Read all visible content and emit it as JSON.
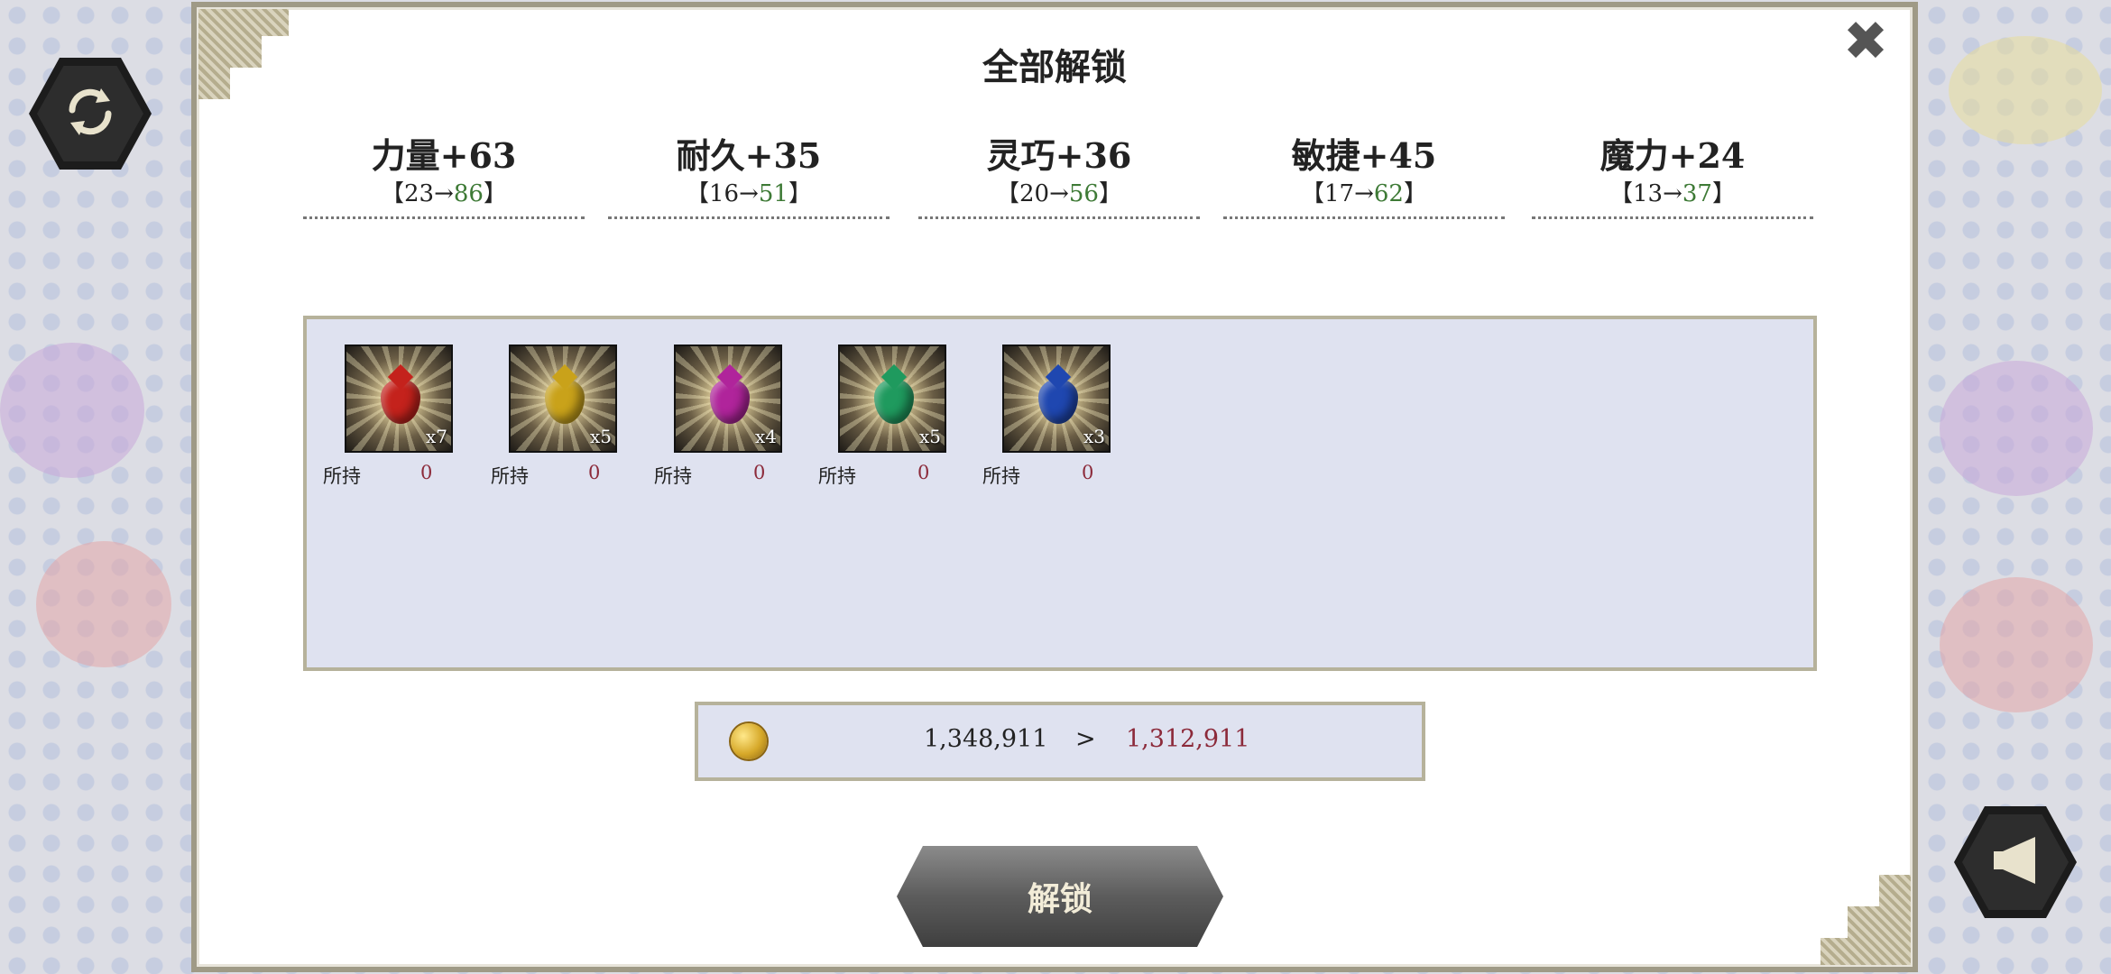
{
  "dialog": {
    "title": "全部解锁",
    "close_icon": "close-icon"
  },
  "stats": [
    {
      "name": "力量+63",
      "range_open": "【23→",
      "range_new": "86",
      "range_close": "】"
    },
    {
      "name": "耐久+35",
      "range_open": "【16→",
      "range_new": "51",
      "range_close": "】"
    },
    {
      "name": "灵巧+36",
      "range_open": "【20→",
      "range_new": "56",
      "range_close": "】"
    },
    {
      "name": "敏捷+45",
      "range_open": "【17→",
      "range_new": "62",
      "range_close": "】"
    },
    {
      "name": "魔力+24",
      "range_open": "【13→",
      "range_new": "37",
      "range_close": "】"
    }
  ],
  "items": [
    {
      "icon": "red-gem-icon",
      "color": "#c4221c",
      "count": "x7",
      "held_label": "所持",
      "held_value": "0"
    },
    {
      "icon": "yellow-gem-icon",
      "color": "#c9a21a",
      "count": "x5",
      "held_label": "所持",
      "held_value": "0"
    },
    {
      "icon": "magenta-gem-icon",
      "color": "#b0249b",
      "count": "x4",
      "held_label": "所持",
      "held_value": "0"
    },
    {
      "icon": "green-gem-icon",
      "color": "#1f9a5e",
      "count": "x5",
      "held_label": "所持",
      "held_value": "0"
    },
    {
      "icon": "blue-gem-icon",
      "color": "#1f47b0",
      "count": "x3",
      "held_label": "所持",
      "held_value": "0"
    }
  ],
  "cost": {
    "icon": "gold-coin-icon",
    "from": "1,348,911",
    "separator": ">",
    "to": "1,312,911"
  },
  "unlock_button": "解锁",
  "side_buttons": {
    "left_icon": "refresh-icon",
    "right_icon": "back-arrow-icon"
  },
  "colors": {
    "accent_green": "#3e7a36",
    "accent_red": "#8c2a3a",
    "panel_bg": "#dfe2f0",
    "border": "#b6b29b"
  }
}
